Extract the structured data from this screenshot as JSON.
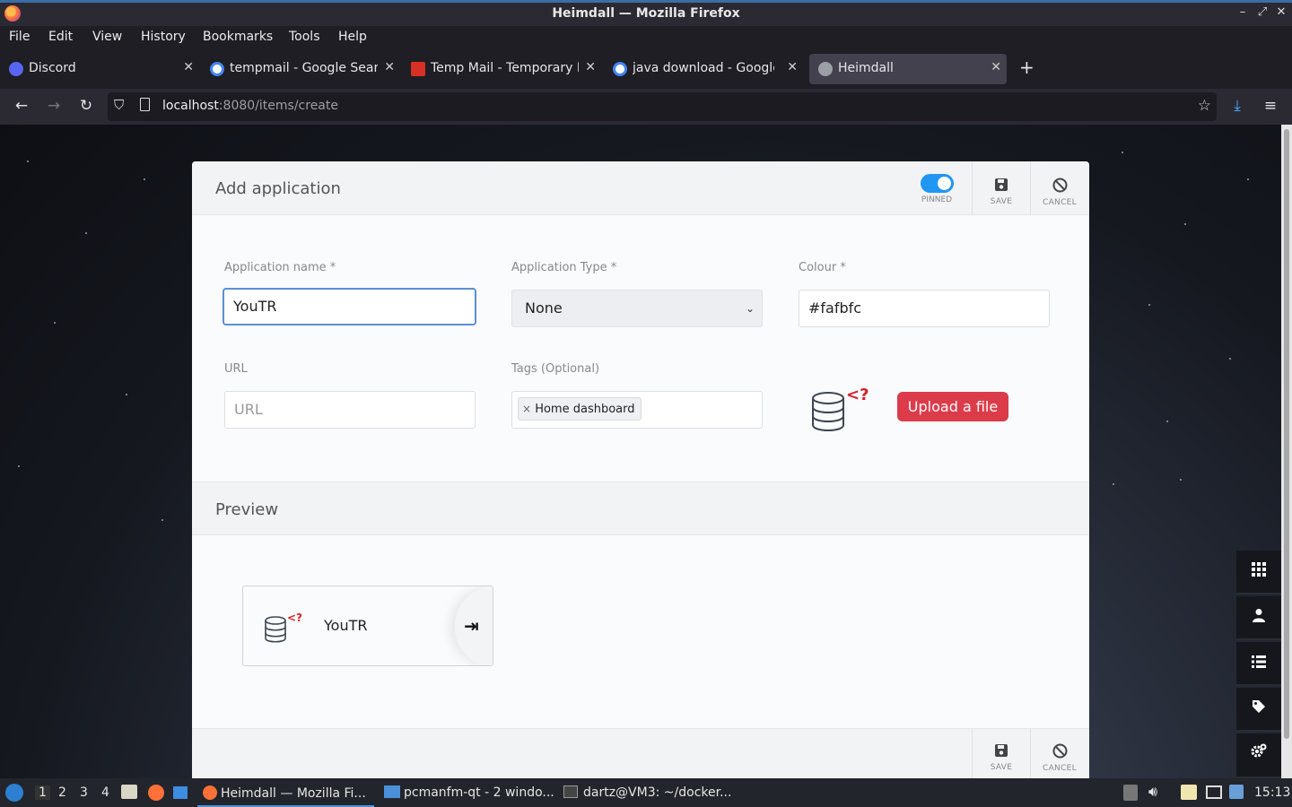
{
  "window": {
    "title": "Heimdall — Mozilla Firefox",
    "controls": [
      "–",
      "⤢",
      "✕"
    ]
  },
  "menu": [
    "File",
    "Edit",
    "View",
    "History",
    "Bookmarks",
    "Tools",
    "Help"
  ],
  "tabs": [
    {
      "label": "Discord",
      "icon": "discord-icon",
      "color": "#5865f2"
    },
    {
      "label": "tempmail - Google Searc",
      "icon": "google-icon",
      "color": "#ffffff"
    },
    {
      "label": "Temp Mail - Temporary E",
      "icon": "gmail-icon",
      "color": "#d93025"
    },
    {
      "label": "java download - Google S",
      "icon": "google-icon",
      "color": "#ffffff"
    },
    {
      "label": "Heimdall",
      "icon": "heimdall-icon",
      "color": "#9aa0a6"
    }
  ],
  "nav": {
    "url_host": "localhost",
    "url_path": ":8080/items/create"
  },
  "form": {
    "header_title": "Add application",
    "pinned_label": "PINNED",
    "pinned": true,
    "save_label": "SAVE",
    "cancel_label": "CANCEL",
    "app_name_label": "Application name *",
    "app_name_value": "YouTR",
    "app_type_label": "Application Type *",
    "app_type_value": "None",
    "colour_label": "Colour *",
    "colour_value": "#fafbfc",
    "url_label": "URL",
    "url_placeholder": "URL",
    "tags_label": "Tags (Optional)",
    "tag_remove": "×",
    "tag_value": "Home dashboard",
    "upload_label": "Upload a file"
  },
  "preview": {
    "title": "Preview",
    "tile_name": "YouTR",
    "link_glyph": "⇥"
  },
  "sidebar_tools": [
    "grid-icon",
    "user-icon",
    "list-icon",
    "tag-icon",
    "settings-icon"
  ],
  "taskbar": {
    "workspaces": [
      "1",
      "2",
      "3",
      "4"
    ],
    "tasks": [
      {
        "label": "Heimdall — Mozilla Fi..."
      },
      {
        "label": "pcmanfm-qt - 2 windo..."
      },
      {
        "label": "dartz@VM3: ~/docker..."
      }
    ],
    "clock": "15:13"
  }
}
